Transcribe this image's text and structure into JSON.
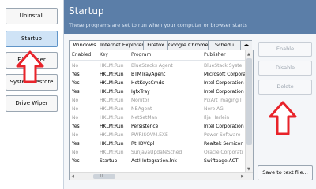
{
  "sidebar": {
    "items": [
      {
        "label": "Uninstall"
      },
      {
        "label": "Startup"
      },
      {
        "label": "File Finder"
      },
      {
        "label": "System Restore"
      },
      {
        "label": "Drive Wiper"
      }
    ]
  },
  "header": {
    "title": "Startup",
    "subtitle": "These programs are set to run when your computer or browser starts"
  },
  "tabs": [
    {
      "label": "Windows"
    },
    {
      "label": "Internet Explorer"
    },
    {
      "label": "Firefox"
    },
    {
      "label": "Google Chrome"
    },
    {
      "label": "Schedu"
    }
  ],
  "table": {
    "columns": [
      "Enabled",
      "Key",
      "Program",
      "Publisher"
    ],
    "rows": [
      {
        "enabled": "No",
        "key": "HKLM:Run",
        "program": "BlueStacks Agent",
        "publisher": "BlueStack Syste"
      },
      {
        "enabled": "Yes",
        "key": "HKLM:Run",
        "program": "BTMTrayAgent",
        "publisher": "Microsoft Corpora"
      },
      {
        "enabled": "Yes",
        "key": "HKLM:Run",
        "program": "HotKeysCmds",
        "publisher": "Intel Corporation"
      },
      {
        "enabled": "Yes",
        "key": "HKLM:Run",
        "program": "IgfxTray",
        "publisher": "Intel Corporation"
      },
      {
        "enabled": "No",
        "key": "HKLM:Run",
        "program": "Monitor",
        "publisher": "PixArt Imaging I"
      },
      {
        "enabled": "No",
        "key": "HKLM:Run",
        "program": "NBAgent",
        "publisher": "Nero AG"
      },
      {
        "enabled": "No",
        "key": "HKLM:Run",
        "program": "NetSetMan",
        "publisher": "Ilja Herlein"
      },
      {
        "enabled": "Yes",
        "key": "HKLM:Run",
        "program": "Persistence",
        "publisher": "Intel Corporation"
      },
      {
        "enabled": "No",
        "key": "HKLM:Run",
        "program": "PWRISOVM.EXE",
        "publisher": "Power Software"
      },
      {
        "enabled": "Yes",
        "key": "HKLM:Run",
        "program": "RtHDVCpl",
        "publisher": "Realtek Semicon"
      },
      {
        "enabled": "No",
        "key": "HKLM:Run",
        "program": "SunJavaUpdateSched",
        "publisher": "Oracle Corporati"
      },
      {
        "enabled": "Yes",
        "key": "Startup",
        "program": "Act! Integration.lnk",
        "publisher": "Swiftpage ACT!"
      }
    ],
    "hscroll_glyph": "III"
  },
  "buttons": {
    "enable": "Enable",
    "disable": "Disable",
    "delete": "Delete",
    "save": "Save to text file..."
  },
  "colors": {
    "accent": "#5b7ea8",
    "annotation_arrow": "#e8232a",
    "disabled_text": "#9a9a9a"
  }
}
